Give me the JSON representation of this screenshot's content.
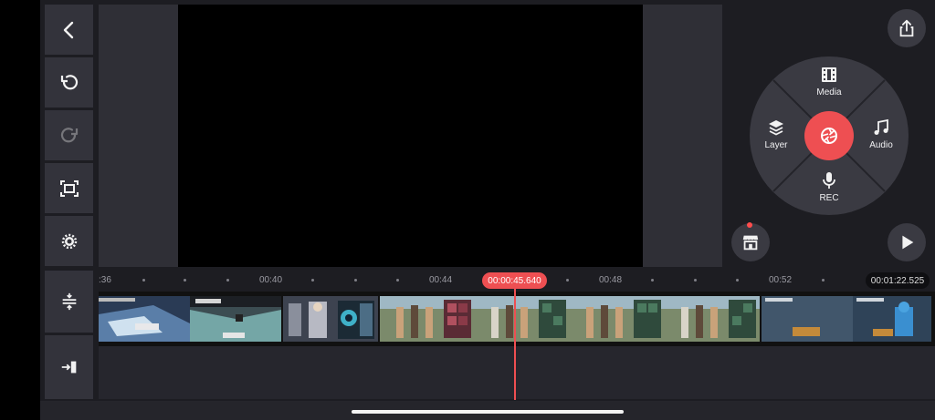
{
  "app": {
    "accent_color": "#ee4f52",
    "background_color": "#1d1d22",
    "panel_color": "#33333b"
  },
  "toolbar": {
    "buttons": [
      {
        "icon": "back-arrow-icon",
        "enabled": true
      },
      {
        "icon": "undo-icon",
        "enabled": true
      },
      {
        "icon": "redo-icon",
        "enabled": false
      },
      {
        "icon": "fullscreen-icon",
        "enabled": true
      },
      {
        "icon": "settings-gear-icon",
        "enabled": true
      }
    ]
  },
  "wheel": {
    "media_label": "Media",
    "layer_label": "Layer",
    "audio_label": "Audio",
    "rec_label": "REC"
  },
  "timeline": {
    "ticks": [
      ":36",
      "00:40",
      "00:44",
      "00:48",
      "00:52"
    ],
    "current_time": "00:00:45.640",
    "total_time": "00:01:22.525"
  }
}
